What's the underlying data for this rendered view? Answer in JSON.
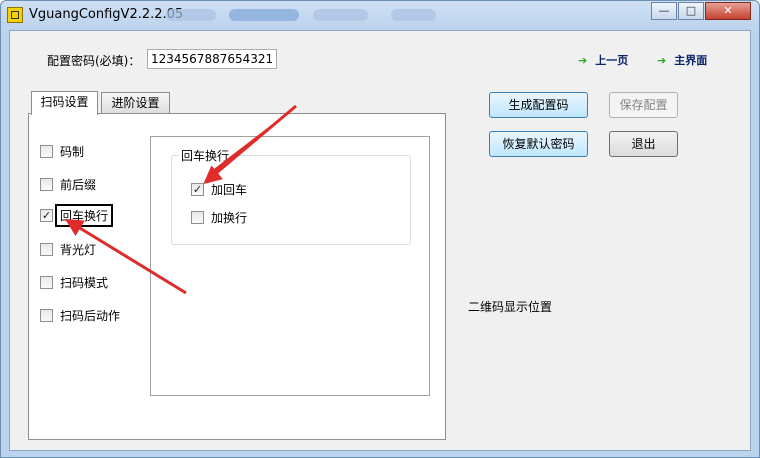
{
  "window": {
    "title": "VguangConfigV2.2.2.05",
    "minimize": "—",
    "maximize": "□",
    "close": "✕"
  },
  "password": {
    "label": "配置密码(必填)：",
    "value": "1234567887654321"
  },
  "nav": {
    "prev": "上一页",
    "main": "主界面"
  },
  "tabs": [
    "扫码设置",
    "进阶设置"
  ],
  "options": [
    {
      "label": "码制",
      "checked": false
    },
    {
      "label": "前后缀",
      "checked": false
    },
    {
      "label": "回车换行",
      "checked": true
    },
    {
      "label": "背光灯",
      "checked": false
    },
    {
      "label": "扫码模式",
      "checked": false
    },
    {
      "label": "扫码后动作",
      "checked": false
    }
  ],
  "group": {
    "title": "回车换行",
    "options": [
      {
        "label": "加回车",
        "checked": true
      },
      {
        "label": "加换行",
        "checked": false
      }
    ]
  },
  "buttons": {
    "generate": "生成配置码",
    "save": "保存配置",
    "restore": "恢复默认密码",
    "exit": "退出"
  },
  "qr_position_label": "二维码显示位置",
  "colors": {
    "annotation_arrow": "#e02b2b",
    "nav_arrow": "#2ba52b"
  }
}
